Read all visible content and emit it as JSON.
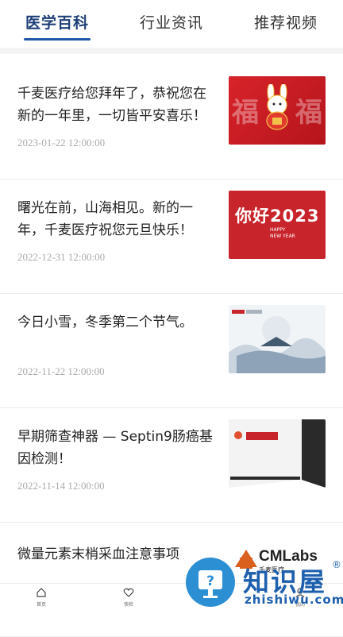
{
  "tabs": [
    {
      "label": "医学百科",
      "active": true
    },
    {
      "label": "行业资讯",
      "active": false
    },
    {
      "label": "推荐视频",
      "active": false
    }
  ],
  "articles": [
    {
      "title": "千麦医疗给您拜年了，恭祝您在新的一年里，一切皆平安喜乐！",
      "date": "2023-01-22 12:00:00"
    },
    {
      "title": "曙光在前，山海相见。新的一年，千麦医疗祝您元旦快乐！",
      "date": "2022-12-31 12:00:00"
    },
    {
      "title": "今日小雪，冬季第二个节气。",
      "date": "2022-11-22 12:00:00"
    },
    {
      "title": "早期筛查神器 — Septin9肠癌基因检测！",
      "date": "2022-11-14 12:00:00"
    },
    {
      "title": "微量元素末梢采血注意事项",
      "date": ""
    }
  ],
  "thumbs": {
    "t2_hello": "你好2023",
    "t2_hny": "HAPPY\nNEW YEAR",
    "t5_brand": "CMLabs",
    "t5_sub": "千麦医疗"
  },
  "bottom_nav": [
    {
      "label": "首页",
      "icon": "home-icon"
    },
    {
      "label": "快检",
      "icon": "heart-icon"
    },
    {
      "label": "我的",
      "icon": "user-icon"
    }
  ],
  "watermark": {
    "text": "知识屋",
    "sub": "zhishiwu.com",
    "reg": "®"
  },
  "colors": {
    "accent": "#1f56a8",
    "red": "#c8242b"
  }
}
